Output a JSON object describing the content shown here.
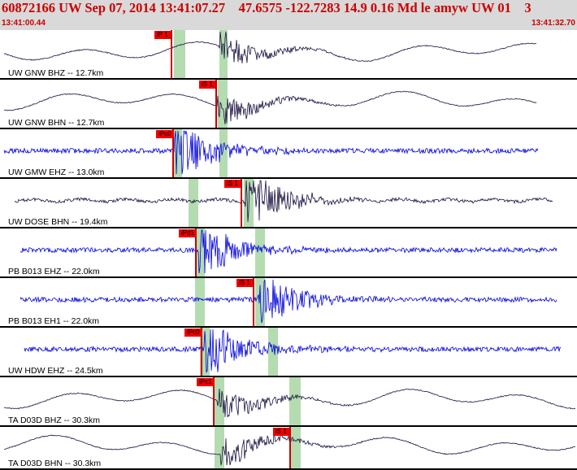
{
  "header": {
    "title": "60872166 UW Sep 07, 2014 13:41:07.27    47.6575 -122.7283 14.9 0.16 Md le amyw UW 01    3",
    "time_start": "13:41:00.44",
    "time_end": "13:41:32.70"
  },
  "colors": {
    "black_trace": "#1a1040",
    "blue_trace": "#0000dd",
    "pick": "#ee0000",
    "band": "#b4dcb0"
  },
  "panels": [
    {
      "label": "UW GNW BHZ -- 12.7km",
      "pick": "iP 1",
      "color": "black"
    },
    {
      "label": "UW GNW BHN -- 12.7km",
      "pick": "iS 1",
      "color": "black"
    },
    {
      "label": "UW GMW EHZ -- 13.0km",
      "pick": "iPc0",
      "color": "blue"
    },
    {
      "label": "UW DOSE BHN -- 19.4km",
      "pick": "iS 1",
      "color": "black"
    },
    {
      "label": "PB B013 EHZ -- 22.0km",
      "pick": "iPd1",
      "color": "blue"
    },
    {
      "label": "PB B013 EH1 -- 22.0km",
      "pick": "iS 1",
      "color": "blue"
    },
    {
      "label": "UW HDW EHZ -- 24.5km",
      "pick": "iPc0",
      "color": "blue"
    },
    {
      "label": "TA D03D BHZ -- 30.3km",
      "pick": "iPc1",
      "color": "black"
    },
    {
      "label": "TA D03D BHN -- 30.3km",
      "pick": "iS 1",
      "color": "black"
    }
  ]
}
